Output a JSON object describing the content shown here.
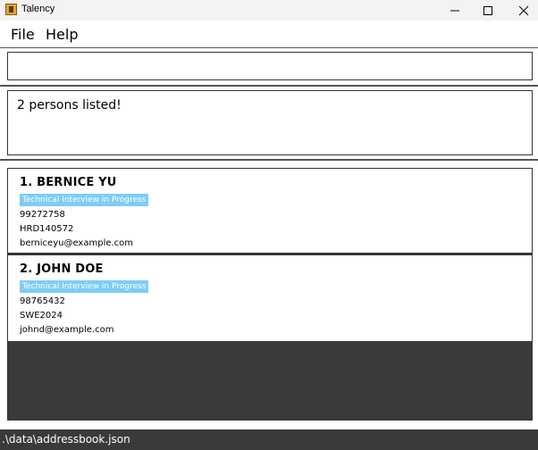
{
  "window": {
    "title": "Talency"
  },
  "menu": {
    "file": "File",
    "help": "Help"
  },
  "command": {
    "value": ""
  },
  "result": {
    "message": "2 persons listed!"
  },
  "persons": [
    {
      "name": "1. BERNICE YU",
      "tag": "Technical Interview in Progress",
      "phone": "99272758",
      "code": "HRD140572",
      "email": "berniceyu@example.com"
    },
    {
      "name": "2. JOHN DOE",
      "tag": "Technical Interview in Progress",
      "phone": "98765432",
      "code": "SWE2024",
      "email": "johnd@example.com"
    }
  ],
  "status": {
    "path": ".\\data\\addressbook.json"
  },
  "colors": {
    "tag_background": "#7ecdf4",
    "list_background": "#3a3a3a",
    "statusbar_background": "#3a3a3a"
  }
}
